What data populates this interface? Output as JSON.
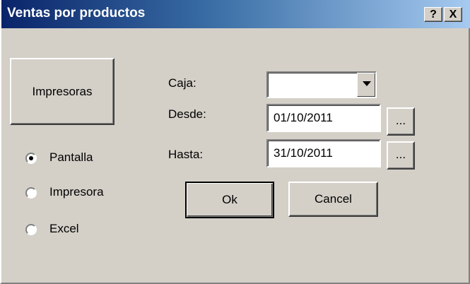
{
  "window": {
    "title": "Ventas por productos",
    "help_label": "?",
    "close_label": "X"
  },
  "printers_button": {
    "label": "Impresoras"
  },
  "output": {
    "options": [
      "Pantalla",
      "Impresora",
      "Excel"
    ],
    "selected": "Pantalla"
  },
  "form": {
    "caja_label": "Caja:",
    "caja_value": "",
    "desde_label": "Desde:",
    "desde_value": "01/10/2011",
    "hasta_label": "Hasta:",
    "hasta_value": "31/10/2011",
    "ellipsis_label": "..."
  },
  "actions": {
    "ok_label": "Ok",
    "cancel_label": "Cancel"
  }
}
